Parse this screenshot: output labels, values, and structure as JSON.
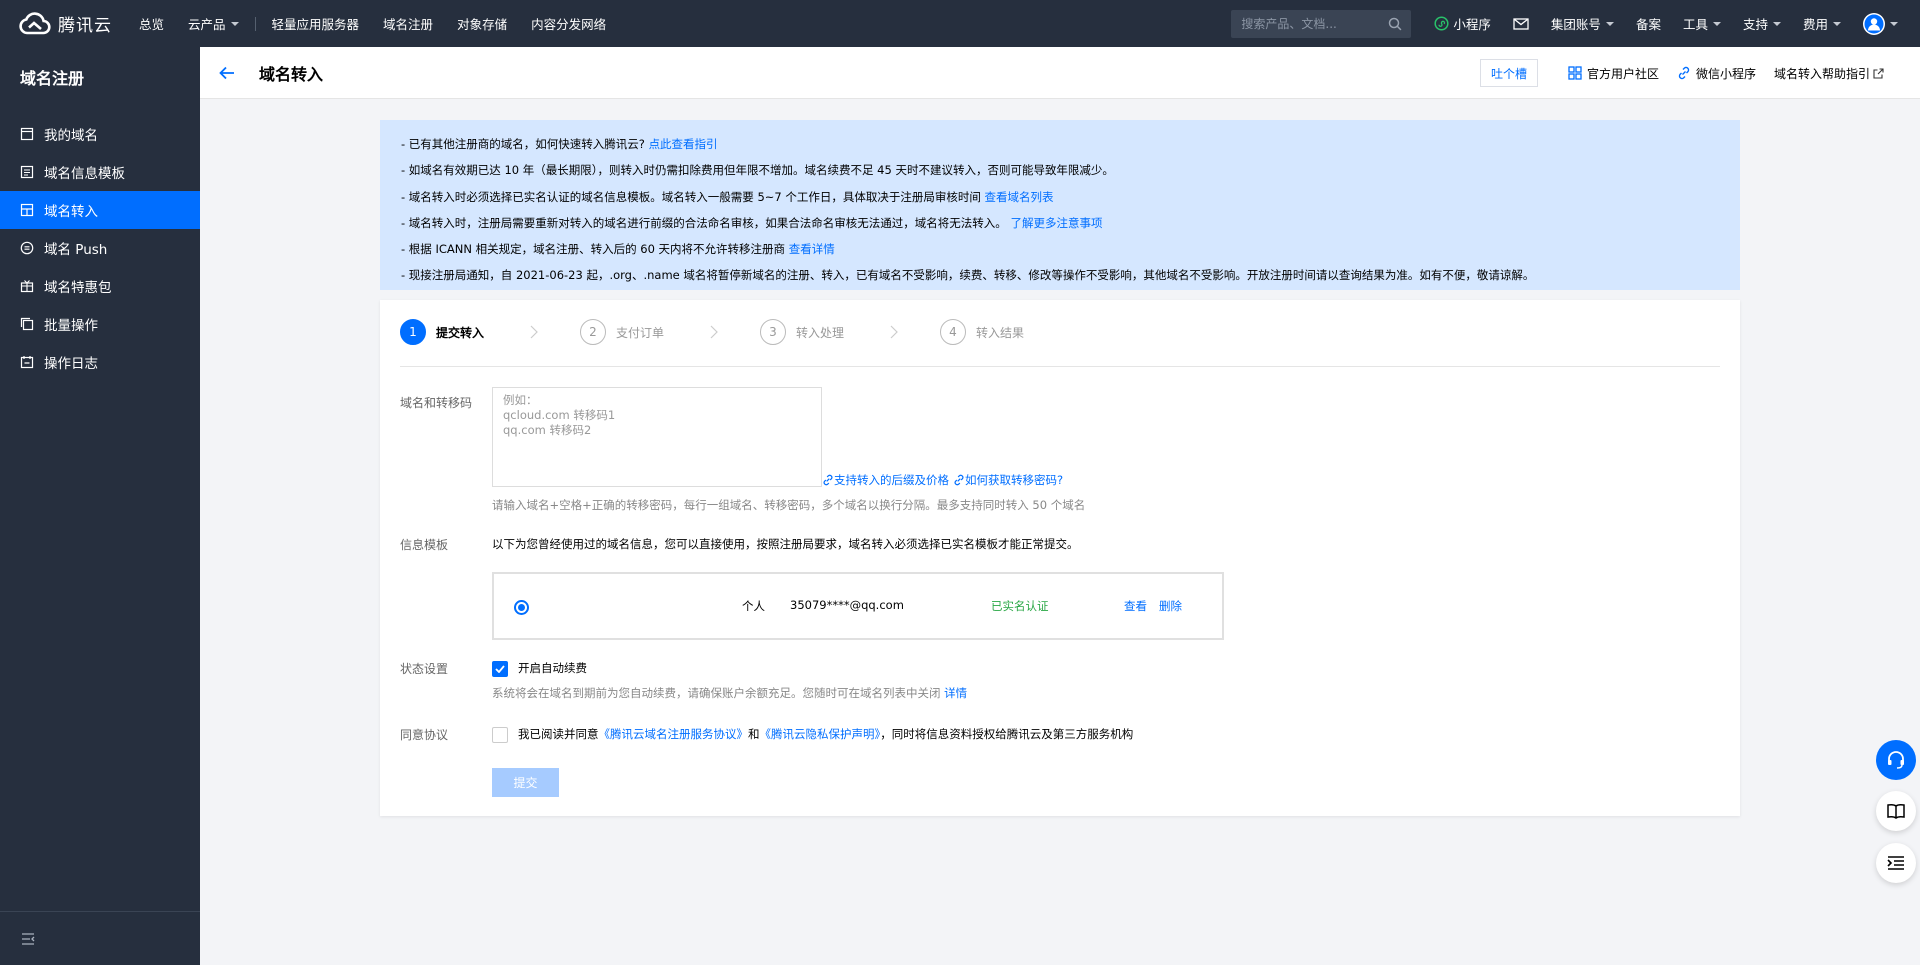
{
  "topbar": {
    "brand": "腾讯云",
    "nav": [
      "总览",
      "云产品",
      "轻量应用服务器",
      "域名注册",
      "对象存储",
      "内容分发网络"
    ],
    "search_placeholder": "搜索产品、文档...",
    "right": {
      "miniprogram": "小程序",
      "group_account": "集团账号",
      "beian": "备案",
      "tools": "工具",
      "support": "支持",
      "fees": "费用"
    }
  },
  "sidebar": {
    "title": "域名注册",
    "items": [
      {
        "label": "我的域名",
        "icon": "calendar-icon"
      },
      {
        "label": "域名信息模板",
        "icon": "document-icon"
      },
      {
        "label": "域名转入",
        "icon": "transfer-icon",
        "active": true
      },
      {
        "label": "域名 Push",
        "icon": "push-icon"
      },
      {
        "label": "域名特惠包",
        "icon": "gift-icon"
      },
      {
        "label": "批量操作",
        "icon": "copy-icon"
      },
      {
        "label": "操作日志",
        "icon": "log-icon"
      }
    ]
  },
  "header": {
    "title": "域名转入",
    "feedback": "吐个槽",
    "community": "官方用户社区",
    "wechat": "微信小程序",
    "help": "域名转入帮助指引"
  },
  "notice": {
    "line1": {
      "text": "- 已有其他注册商的域名，如何快速转入腾讯云? ",
      "link": "点此查看指引"
    },
    "line2": {
      "text": "- 如域名有效期已达 10 年（最长期限），则转入时仍需扣除费用但年限不增加。域名续费不足 45 天时不建议转入，否则可能导致年限减少。"
    },
    "line3": {
      "text": "- 域名转入时必须选择已实名认证的域名信息模板。域名转入一般需要 5~7 个工作日，具体取决于注册局审核时间 ",
      "link": "查看域名列表"
    },
    "line4": {
      "text": "- 域名转入时，注册局需要重新对转入的域名进行前缀的合法命名审核，如果合法命名审核无法通过，域名将无法转入。 ",
      "link": "了解更多注意事项"
    },
    "line5": {
      "text": "- 根据 ICANN 相关规定，域名注册、转入后的 60 天内将不允许转移注册商 ",
      "link": "查看详情"
    },
    "line6": {
      "text": "- 现接注册局通知，自 2021-06-23 起，.org、.name 域名将暂停新域名的注册、转入，已有域名不受影响，续费、转移、修改等操作不受影响，其他域名不受影响。开放注册时间请以查询结果为准。如有不便，敬请谅解。"
    }
  },
  "steps": [
    {
      "num": "1",
      "label": "提交转入"
    },
    {
      "num": "2",
      "label": "支付订单"
    },
    {
      "num": "3",
      "label": "转入处理"
    },
    {
      "num": "4",
      "label": "转入结果"
    }
  ],
  "form": {
    "domain_label": "域名和转移码",
    "domain_placeholder": "例如：\nqcloud.com 转移码1\nqq.com 转移码2",
    "link_suffix": "支持转入的后缀及价格",
    "link_code": "如何获取转移密码?",
    "domain_hint": "请输入域名+空格+正确的转移密码，每行一组域名、转移密码，多个域名以换行分隔。最多支持同时转入 50 个域名",
    "template_label": "信息模板",
    "template_desc": "以下为您曾经使用过的域名信息，您可以直接使用，按照注册局要求，域名转入必须选择已实名模板才能正常提交。",
    "template": {
      "type": "个人",
      "email": "35079****@qq.com",
      "status": "已实名认证",
      "view": "查看",
      "delete": "删除"
    },
    "status_label": "状态设置",
    "auto_renew": "开启自动续费",
    "auto_renew_hint": "系统将会在域名到期前为您自动续费，请确保账户余额充足。您随时可在域名列表中关闭 ",
    "auto_renew_detail": "详情",
    "agree_label": "同意协议",
    "agree_prefix": "我已阅读并同意",
    "agree_link1": "《腾讯云域名注册服务协议》",
    "agree_and": "和",
    "agree_link2": "《腾讯云隐私保护声明》",
    "agree_suffix": "，同时将信息资料授权给腾讯云及第三方服务机构",
    "submit": "提交"
  },
  "colors": {
    "brand": "#006eff",
    "sidebar": "#262f3e",
    "notice_bg": "#d5e7ff",
    "verified": "#29a745"
  }
}
